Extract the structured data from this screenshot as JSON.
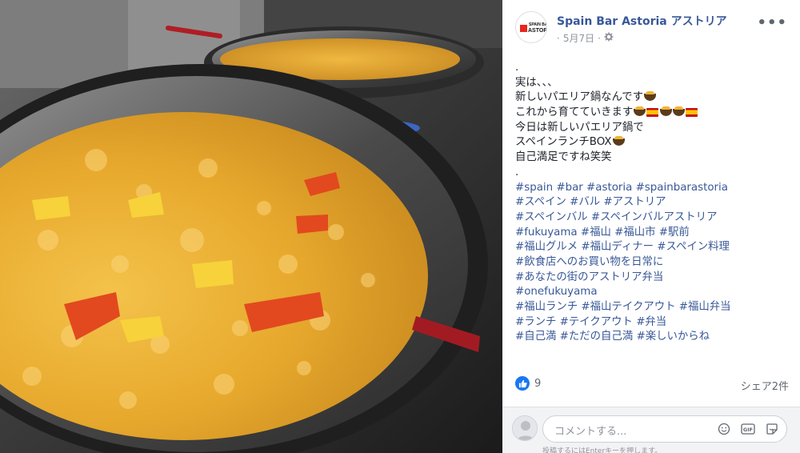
{
  "post": {
    "page_name": "Spain Bar Astoria アストリア",
    "date": "5月7日",
    "separator": "·",
    "logo_text_top": "SPAIN BAR",
    "logo_text_main": "ASTORIA",
    "text_lines": [
      {
        "text": "."
      },
      {
        "text": "実は、、、"
      },
      {
        "text": "新しいパエリア鍋なんです",
        "emojis": [
          "paella"
        ]
      },
      {
        "text": "これから育てていきます",
        "emojis": [
          "paella",
          "flag-spain",
          "paella",
          "paella",
          "flag-spain"
        ]
      },
      {
        "text": "今日は新しいパエリア鍋で"
      },
      {
        "text": "スペインランチBOX",
        "emojis": [
          "paella"
        ]
      },
      {
        "text": "自己満足ですね笑笑"
      },
      {
        "text": "."
      }
    ],
    "hashtag_lines": [
      "#spain #bar #astoria #spainbarastoria",
      "#スペイン #バル #アストリア",
      "#スペインバル #スペインバルアストリア",
      "#fukuyama #福山 #福山市 #駅前",
      "#福山グルメ #福山ディナー #スペイン料理",
      "#飲食店へのお買い物を日常に",
      "#あなたの街のアストリア弁当",
      "#onefukuyama",
      "#福山ランチ #福山テイクアウト #福山弁当",
      "#ランチ #テイクアウト #弁当",
      "#自己満 #ただの自己満 #楽しいからね"
    ]
  },
  "reactions": {
    "like_count": "9",
    "shares": "シェア2件"
  },
  "comment": {
    "placeholder": "コメントする...",
    "hint": "投稿するにはEnterキーを押します。"
  },
  "colors": {
    "link": "#385898",
    "like_blue": "#1877f2",
    "muted": "#90949c"
  },
  "icons": [
    "gear-icon",
    "more-icon",
    "like-icon",
    "emoji-icon",
    "gif-icon",
    "sticker-icon",
    "paella-emoji",
    "spain-flag-emoji"
  ]
}
